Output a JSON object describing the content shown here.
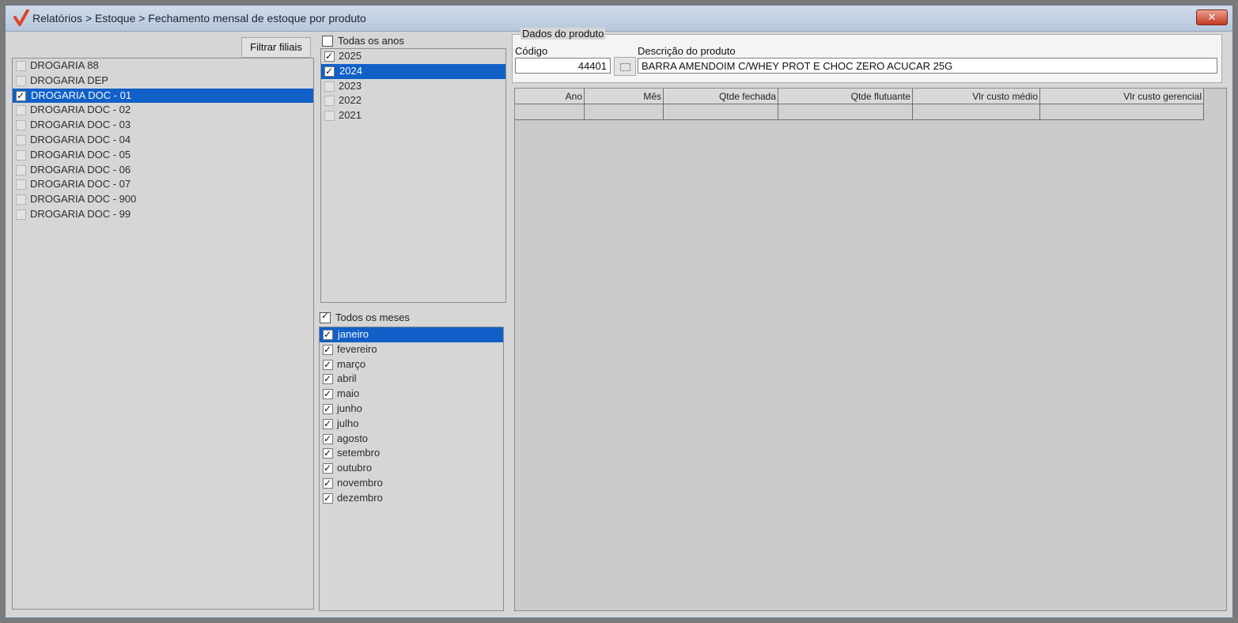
{
  "window": {
    "title": "Relatórios > Estoque > Fechamento mensal de estoque por produto",
    "close_symbol": "✕"
  },
  "filiais": {
    "filter_button": "Filtrar filiais",
    "items": [
      {
        "label": "DROGARIA 88",
        "checked": false,
        "selected": false
      },
      {
        "label": "DROGARIA DEP",
        "checked": false,
        "selected": false
      },
      {
        "label": "DROGARIA DOC - 01",
        "checked": true,
        "selected": true
      },
      {
        "label": "DROGARIA DOC - 02",
        "checked": false,
        "selected": false
      },
      {
        "label": "DROGARIA DOC - 03",
        "checked": false,
        "selected": false
      },
      {
        "label": "DROGARIA DOC - 04",
        "checked": false,
        "selected": false
      },
      {
        "label": "DROGARIA DOC - 05",
        "checked": false,
        "selected": false
      },
      {
        "label": "DROGARIA DOC - 06",
        "checked": false,
        "selected": false
      },
      {
        "label": "DROGARIA DOC - 07",
        "checked": false,
        "selected": false
      },
      {
        "label": "DROGARIA DOC - 900",
        "checked": false,
        "selected": false
      },
      {
        "label": "DROGARIA DOC - 99",
        "checked": false,
        "selected": false
      }
    ]
  },
  "anos": {
    "all_label": "Todas os anos",
    "all_checked": false,
    "items": [
      {
        "label": "2025",
        "checked": true,
        "selected": false
      },
      {
        "label": "2024",
        "checked": true,
        "selected": true
      },
      {
        "label": "2023",
        "checked": false,
        "selected": false
      },
      {
        "label": "2022",
        "checked": false,
        "selected": false
      },
      {
        "label": "2021",
        "checked": false,
        "selected": false
      }
    ]
  },
  "meses": {
    "all_label": "Todos os meses",
    "all_checked": true,
    "items": [
      {
        "label": "janeiro",
        "checked": true,
        "selected": true
      },
      {
        "label": "fevereiro",
        "checked": true,
        "selected": false
      },
      {
        "label": "março",
        "checked": true,
        "selected": false
      },
      {
        "label": "abril",
        "checked": true,
        "selected": false
      },
      {
        "label": "maio",
        "checked": true,
        "selected": false
      },
      {
        "label": "junho",
        "checked": true,
        "selected": false
      },
      {
        "label": "julho",
        "checked": true,
        "selected": false
      },
      {
        "label": "agosto",
        "checked": true,
        "selected": false
      },
      {
        "label": "setembro",
        "checked": true,
        "selected": false
      },
      {
        "label": "outubro",
        "checked": true,
        "selected": false
      },
      {
        "label": "novembro",
        "checked": true,
        "selected": false
      },
      {
        "label": "dezembro",
        "checked": true,
        "selected": false
      }
    ]
  },
  "produto": {
    "group_label": "Dados do produto",
    "codigo_label": "Código",
    "codigo_value": "44401",
    "descricao_label": "Descrição do produto",
    "descricao_value": "BARRA AMENDOIM C/WHEY PROT E CHOC ZERO ACUCAR 25G"
  },
  "grid": {
    "columns": [
      "Ano",
      "Mês",
      "Qtde fechada",
      "Qtde flutuante",
      "Vlr custo médio",
      "Vlr custo gerencial"
    ]
  },
  "colors": {
    "selection": "#1160c8",
    "window_bg": "#d6d6d6",
    "accent_check": "#e0452b"
  }
}
